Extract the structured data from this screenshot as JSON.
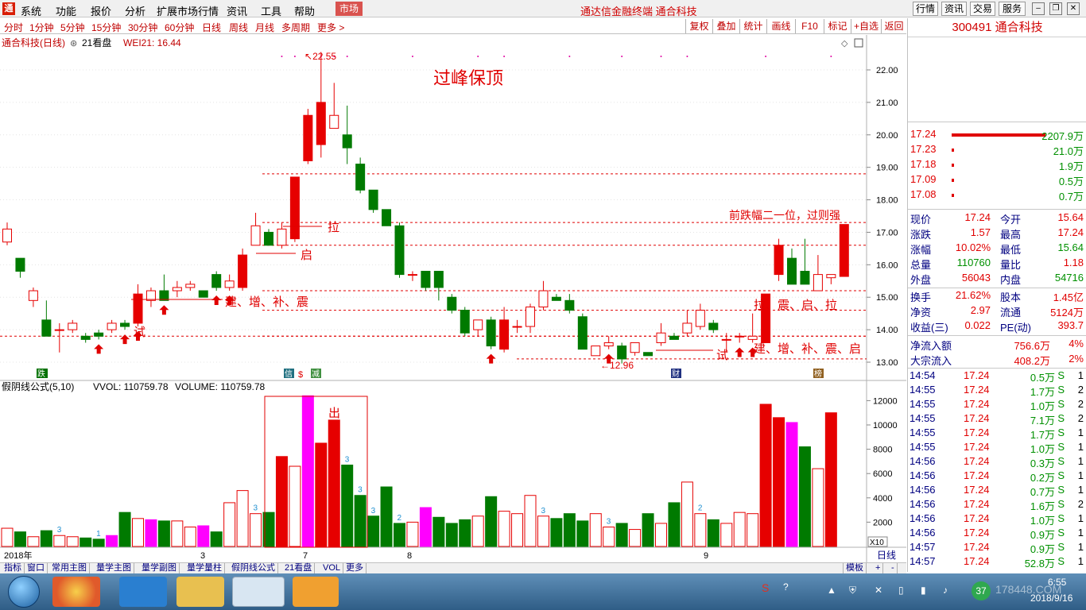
{
  "menubar": {
    "items": [
      "系统",
      "功能",
      "报价",
      "分析",
      "扩展市场行情",
      "资讯",
      "工具",
      "帮助"
    ],
    "market_button": "市场",
    "title": "通达信金融终端 通合科技",
    "right_buttons": [
      "行情",
      "资讯",
      "交易",
      "服务"
    ]
  },
  "periodbar": {
    "periods": [
      "分时",
      "1分钟",
      "5分钟",
      "15分钟",
      "30分钟",
      "60分钟",
      "日线",
      "周线",
      "月线",
      "多周期",
      "更多 >"
    ],
    "tools": [
      "复权",
      "叠加",
      "统计",
      "画线",
      "F10",
      "标记",
      "+自选",
      "返回"
    ]
  },
  "chart_header": {
    "stock_label": "通合科技(日线)",
    "template": "21看盘",
    "ma_label": "WEI21: 16.44"
  },
  "vol_header": {
    "formula": "假阴线公式(5,10)",
    "vvol": "VVOL: 110759.78",
    "volume": "VOLUME: 110759.78"
  },
  "annotations": {
    "main_title": "过峰保顶",
    "high_price": "22.55",
    "low_price": "12.96",
    "la": "拉",
    "qi": "启",
    "jian_zeng_bu_zhen": "建、增、补、震",
    "shi1": "试",
    "shi2": "试",
    "right_note": "前跌幅二一位，过则强",
    "la_zhen_qi_la": "拉、震、启、拉",
    "jian_zeng_bu_zhen_qi": "建、增、补、震、启",
    "out": "出",
    "markers": {
      "die": "跌",
      "xin": "信",
      "s": "$",
      "jian": "减",
      "cai": "财",
      "bang": "榜"
    },
    "vol_counts": [
      "3",
      "1",
      "3",
      "3",
      "3",
      "3",
      "2",
      "3",
      "3",
      "2"
    ]
  },
  "chart_data": {
    "type": "candlestick",
    "y_axis_ticks": [
      "22.00",
      "21.00",
      "20.00",
      "19.00",
      "18.00",
      "17.00",
      "16.00",
      "15.00",
      "14.00",
      "13.00"
    ],
    "vol_axis_ticks": [
      "12000",
      "10000",
      "8000",
      "6000",
      "4000",
      "2000"
    ],
    "x_labels": [
      "2018年",
      "3",
      "7",
      "8",
      "9"
    ],
    "x_unit_label": "日线",
    "vol_scale_label": "X10",
    "candles": [
      {
        "o": 16.7,
        "h": 17.3,
        "l": 16.6,
        "c": 17.1
      },
      {
        "o": 16.2,
        "h": 16.1,
        "l": 15.6,
        "c": 15.8
      },
      {
        "o": 14.9,
        "h": 15.3,
        "l": 14.7,
        "c": 15.2
      },
      {
        "o": 14.3,
        "h": 14.9,
        "l": 13.8,
        "c": 13.8
      },
      {
        "o": 14.0,
        "h": 14.2,
        "l": 13.3,
        "c": 14.0
      },
      {
        "o": 14.0,
        "h": 14.3,
        "l": 13.9,
        "c": 14.2
      },
      {
        "o": 13.8,
        "h": 13.9,
        "l": 13.6,
        "c": 13.7
      },
      {
        "o": 13.9,
        "h": 14.0,
        "l": 13.7,
        "c": 13.8
      },
      {
        "o": 14.0,
        "h": 14.3,
        "l": 13.9,
        "c": 14.2
      },
      {
        "o": 14.2,
        "h": 14.3,
        "l": 14.0,
        "c": 14.1
      },
      {
        "o": 14.2,
        "h": 15.4,
        "l": 14.1,
        "c": 15.1
      },
      {
        "o": 14.9,
        "h": 15.3,
        "l": 14.7,
        "c": 15.2
      },
      {
        "o": 15.2,
        "h": 15.7,
        "l": 14.9,
        "c": 14.9
      },
      {
        "o": 15.2,
        "h": 15.5,
        "l": 15.0,
        "c": 15.3
      },
      {
        "o": 15.3,
        "h": 15.5,
        "l": 15.2,
        "c": 15.4
      },
      {
        "o": 15.2,
        "h": 15.2,
        "l": 15.0,
        "c": 15.0
      },
      {
        "o": 15.7,
        "h": 15.8,
        "l": 15.2,
        "c": 15.3
      },
      {
        "o": 15.3,
        "h": 15.7,
        "l": 15.2,
        "c": 15.5
      },
      {
        "o": 15.3,
        "h": 16.5,
        "l": 15.2,
        "c": 16.3
      },
      {
        "o": 16.6,
        "h": 17.6,
        "l": 16.6,
        "c": 17.2
      },
      {
        "o": 17.0,
        "h": 17.1,
        "l": 16.6,
        "c": 16.6
      },
      {
        "o": 16.6,
        "h": 17.3,
        "l": 16.5,
        "c": 17.1
      },
      {
        "o": 16.8,
        "h": 18.7,
        "l": 16.7,
        "c": 18.7
      },
      {
        "o": 19.2,
        "h": 20.8,
        "l": 19.1,
        "c": 20.6
      },
      {
        "o": 19.7,
        "h": 22.55,
        "l": 19.3,
        "c": 21.0
      },
      {
        "o": 20.2,
        "h": 21.6,
        "l": 20.2,
        "c": 20.6
      },
      {
        "o": 20.0,
        "h": 20.9,
        "l": 19.1,
        "c": 19.6
      },
      {
        "o": 19.1,
        "h": 19.3,
        "l": 18.2,
        "c": 18.3
      },
      {
        "o": 18.3,
        "h": 18.3,
        "l": 17.6,
        "c": 17.7
      },
      {
        "o": 17.7,
        "h": 17.7,
        "l": 17.2,
        "c": 17.2
      },
      {
        "o": 17.2,
        "h": 17.3,
        "l": 15.6,
        "c": 15.7
      },
      {
        "o": 15.7,
        "h": 15.8,
        "l": 15.5,
        "c": 15.7
      },
      {
        "o": 15.8,
        "h": 15.8,
        "l": 15.2,
        "c": 15.3
      },
      {
        "o": 15.8,
        "h": 15.8,
        "l": 14.9,
        "c": 15.3
      },
      {
        "o": 15.0,
        "h": 15.1,
        "l": 14.5,
        "c": 14.6
      },
      {
        "o": 14.6,
        "h": 14.7,
        "l": 13.8,
        "c": 13.9
      },
      {
        "o": 14.0,
        "h": 14.3,
        "l": 13.8,
        "c": 14.3
      },
      {
        "o": 14.3,
        "h": 14.4,
        "l": 13.4,
        "c": 13.5
      },
      {
        "o": 13.4,
        "h": 14.7,
        "l": 13.3,
        "c": 14.3
      },
      {
        "o": 14.1,
        "h": 14.3,
        "l": 13.9,
        "c": 14.1
      },
      {
        "o": 14.1,
        "h": 14.8,
        "l": 13.9,
        "c": 14.7
      },
      {
        "o": 14.7,
        "h": 15.5,
        "l": 14.6,
        "c": 15.2
      },
      {
        "o": 15.0,
        "h": 15.1,
        "l": 14.9,
        "c": 14.9
      },
      {
        "o": 14.9,
        "h": 15.1,
        "l": 14.5,
        "c": 14.6
      },
      {
        "o": 14.4,
        "h": 14.5,
        "l": 13.4,
        "c": 13.4
      },
      {
        "o": 13.2,
        "h": 13.5,
        "l": 13.2,
        "c": 13.5
      },
      {
        "o": 13.5,
        "h": 13.8,
        "l": 13.4,
        "c": 13.6
      },
      {
        "o": 13.5,
        "h": 13.6,
        "l": 12.96,
        "c": 13.1
      },
      {
        "o": 13.3,
        "h": 13.6,
        "l": 13.2,
        "c": 13.6
      },
      {
        "o": 13.3,
        "h": 13.3,
        "l": 13.2,
        "c": 13.2
      },
      {
        "o": 13.6,
        "h": 14.2,
        "l": 13.5,
        "c": 13.9
      },
      {
        "o": 13.8,
        "h": 13.9,
        "l": 13.7,
        "c": 13.7
      },
      {
        "o": 13.9,
        "h": 14.6,
        "l": 13.8,
        "c": 14.2
      },
      {
        "o": 14.1,
        "h": 14.8,
        "l": 14.0,
        "c": 14.6
      },
      {
        "o": 14.2,
        "h": 14.3,
        "l": 13.9,
        "c": 14.0
      },
      {
        "o": 13.7,
        "h": 13.9,
        "l": 13.3,
        "c": 13.7
      },
      {
        "o": 13.8,
        "h": 13.9,
        "l": 13.6,
        "c": 13.8
      },
      {
        "o": 13.7,
        "h": 14.5,
        "l": 13.6,
        "c": 13.8
      },
      {
        "o": 13.6,
        "h": 15.1,
        "l": 13.6,
        "c": 15.1
      },
      {
        "o": 15.7,
        "h": 16.8,
        "l": 15.5,
        "c": 16.6
      },
      {
        "o": 16.2,
        "h": 16.5,
        "l": 15.4,
        "c": 15.4
      },
      {
        "o": 15.8,
        "h": 16.8,
        "l": 15.5,
        "c": 15.4
      },
      {
        "o": 15.2,
        "h": 16.3,
        "l": 15.2,
        "c": 15.7
      },
      {
        "o": 15.6,
        "h": 15.7,
        "l": 15.4,
        "c": 15.7
      },
      {
        "o": 15.64,
        "h": 17.24,
        "l": 15.64,
        "c": 17.24
      }
    ],
    "volume": [
      1500,
      1200,
      800,
      1300,
      900,
      800,
      700,
      600,
      900,
      2800,
      2300,
      2200,
      2100,
      2100,
      1600,
      1700,
      1200,
      3600,
      4600,
      2700,
      2800,
      7400,
      6600,
      12400,
      8500,
      10400,
      6700,
      4200,
      2500,
      4900,
      1900,
      2000,
      3200,
      2400,
      1900,
      2200,
      2500,
      4100,
      2900,
      2700,
      4200,
      2500,
      2300,
      2700,
      2100,
      2700,
      1600,
      1900,
      1400,
      2700,
      1900,
      3600,
      5300,
      2700,
      2200,
      1900,
      2800,
      2700,
      11700,
      10600,
      10200,
      8200,
      6400,
      11000
    ],
    "magenta_vol_idx": [
      8,
      11,
      15,
      23,
      32,
      60
    ],
    "sell_levels": [
      18.8,
      17.3,
      16.6,
      15.2,
      14.6,
      13.8
    ]
  },
  "quote": {
    "code_name": "300491 通合科技",
    "order_book": [
      {
        "price": "17.24",
        "vol": "2207.9万",
        "bar": 1.0
      },
      {
        "price": "17.23",
        "vol": "21.0万",
        "bar": 0.0
      },
      {
        "price": "17.18",
        "vol": "1.9万",
        "bar": 0.0
      },
      {
        "price": "17.09",
        "vol": "0.5万",
        "bar": 0.0
      },
      {
        "price": "17.08",
        "vol": "0.7万",
        "bar": 0.0
      }
    ],
    "stats": [
      [
        "现价",
        "17.24",
        "今开",
        "15.64"
      ],
      [
        "涨跌",
        "1.57",
        "最高",
        "17.24"
      ],
      [
        "涨幅",
        "10.02%",
        "最低",
        "15.64"
      ],
      [
        "总量",
        "110760",
        "量比",
        "1.18"
      ],
      [
        "外盘",
        "56043",
        "内盘",
        "54716"
      ]
    ],
    "stats2": [
      [
        "换手",
        "21.62%",
        "股本",
        "1.45亿"
      ],
      [
        "净资",
        "2.97",
        "流通",
        "5124万"
      ],
      [
        "收益(三)",
        "0.022",
        "PE(动)",
        "393.7"
      ]
    ],
    "flows": [
      [
        "净流入额",
        "756.6万",
        "4%"
      ],
      [
        "大宗流入",
        "408.2万",
        "2%"
      ]
    ],
    "ticks": [
      [
        "14:54",
        "17.24",
        "0.5万",
        "S",
        "1"
      ],
      [
        "14:55",
        "17.24",
        "1.7万",
        "S",
        "2"
      ],
      [
        "14:55",
        "17.24",
        "1.0万",
        "S",
        "2"
      ],
      [
        "14:55",
        "17.24",
        "7.1万",
        "S",
        "2"
      ],
      [
        "14:55",
        "17.24",
        "1.7万",
        "S",
        "1"
      ],
      [
        "14:55",
        "17.24",
        "1.0万",
        "S",
        "1"
      ],
      [
        "14:56",
        "17.24",
        "0.3万",
        "S",
        "1"
      ],
      [
        "14:56",
        "17.24",
        "0.2万",
        "S",
        "1"
      ],
      [
        "14:56",
        "17.24",
        "0.7万",
        "S",
        "1"
      ],
      [
        "14:56",
        "17.24",
        "1.6万",
        "S",
        "2"
      ],
      [
        "14:56",
        "17.24",
        "1.0万",
        "S",
        "1"
      ],
      [
        "14:56",
        "17.24",
        "0.9万",
        "S",
        "1"
      ],
      [
        "14:57",
        "17.24",
        "0.9万",
        "S",
        "1"
      ],
      [
        "14:57",
        "17.24",
        "52.8万",
        "S",
        "1"
      ]
    ]
  },
  "bottombar": {
    "tabs": [
      "指标",
      "窗口",
      "常用主图",
      "量学主图",
      "量学副图",
      "量学量柱",
      "假阴线公式",
      "21看盘",
      "VOL",
      "更多"
    ],
    "template_tab": "模板"
  },
  "taskbar": {
    "clock": "6:55",
    "date": "2018/9/16",
    "badge": "37",
    "watermark": "178448.COM"
  }
}
